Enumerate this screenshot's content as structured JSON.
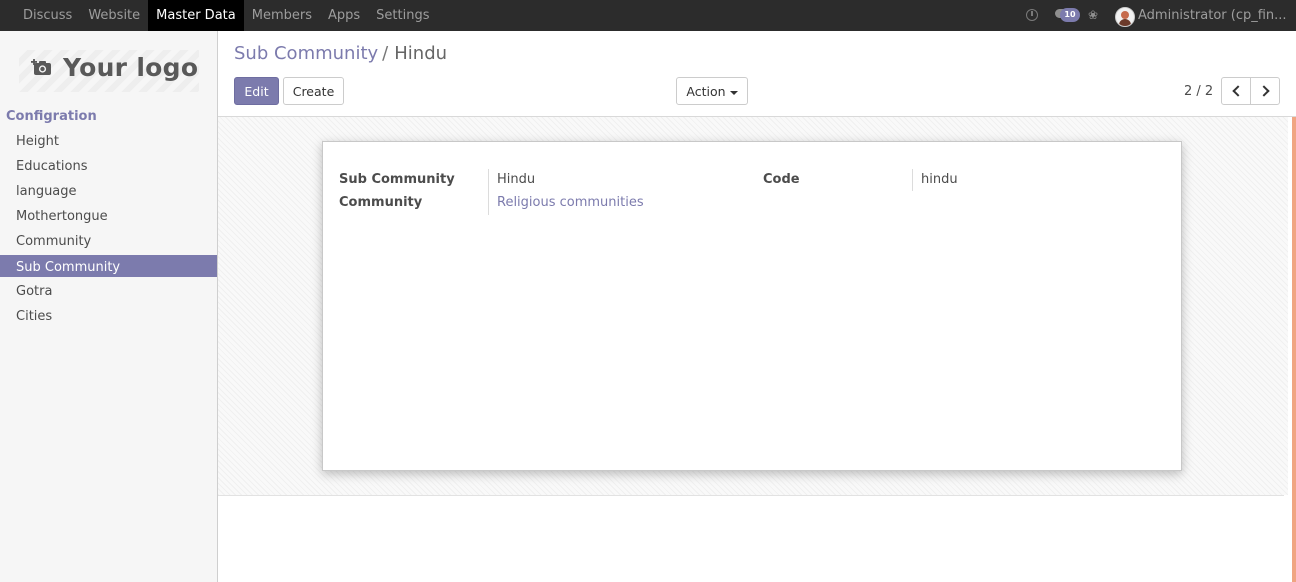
{
  "topbar": {
    "menu": [
      "Discuss",
      "Website",
      "Master Data",
      "Members",
      "Apps",
      "Settings"
    ],
    "active_menu": "Master Data",
    "chat_count": "10",
    "user_name": "Administrator (cp_fin..."
  },
  "sidebar": {
    "logo_text": "Your logo",
    "section_title": "Configration",
    "items": [
      "Height",
      "Educations",
      "language",
      "Mothertongue",
      "Community",
      "Sub Community",
      "Gotra",
      "Cities"
    ],
    "active_item": "Sub Community"
  },
  "control_panel": {
    "breadcrumb_parent": "Sub Community",
    "breadcrumb_separator": "/",
    "breadcrumb_current": "Hindu",
    "edit_label": "Edit",
    "create_label": "Create",
    "action_label": "Action",
    "pager": "2 / 2"
  },
  "form": {
    "sub_community_label": "Sub Community",
    "sub_community_value": "Hindu",
    "community_label": "Community",
    "community_value": "Religious communities",
    "code_label": "Code",
    "code_value": "hindu"
  },
  "colors": {
    "brand": "#7c7bad",
    "topbar": "#2c2c2c",
    "accent_scrollbar": "#f0a582"
  }
}
